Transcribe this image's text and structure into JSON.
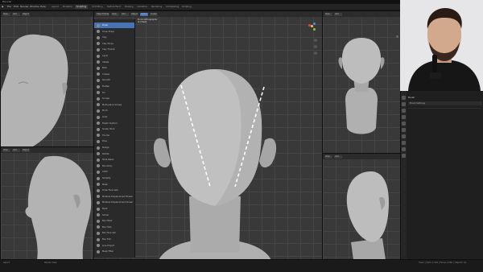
{
  "window": {
    "title": "Blender",
    "controls": [
      "–",
      "□",
      "✕"
    ]
  },
  "menubar": {
    "items": [
      "File",
      "Edit",
      "Render",
      "Window",
      "Help"
    ],
    "workspaces": [
      "Layout",
      "Modeling",
      "Sculpting",
      "UV Editing",
      "Texture Paint",
      "Shading",
      "Animation",
      "Rendering",
      "Compositing",
      "Scripting"
    ],
    "active_workspace": "Sculpting"
  },
  "viewport_main": {
    "header_buttons": [
      "Object Mode",
      "View",
      "Add",
      "Object",
      "Global",
      "Sculpt"
    ],
    "info_line1": "Front Orthographic",
    "info_line2": "(1) Head"
  },
  "viewport_small": {
    "header_buttons": [
      "View",
      "Add",
      "Object"
    ]
  },
  "brushes": {
    "items": [
      {
        "label": "Draw",
        "active": true
      },
      {
        "label": "Draw Sharp",
        "active": false
      },
      {
        "label": "Clay",
        "active": false
      },
      {
        "label": "Clay Strips",
        "active": false
      },
      {
        "label": "Clay Thumb",
        "active": false
      },
      {
        "label": "Layer",
        "active": false
      },
      {
        "label": "Inflate",
        "active": false
      },
      {
        "label": "Blob",
        "active": false
      },
      {
        "label": "Crease",
        "active": false
      },
      {
        "label": "Smooth",
        "active": false
      },
      {
        "label": "Flatten",
        "active": false
      },
      {
        "label": "Fill",
        "active": false
      },
      {
        "label": "Scrape",
        "active": false
      },
      {
        "label": "Multi-plane Scrape",
        "active": false
      },
      {
        "label": "Pinch",
        "active": false
      },
      {
        "label": "Grab",
        "active": false
      },
      {
        "label": "Elastic Deform",
        "active": false
      },
      {
        "label": "Snake Hook",
        "active": false
      },
      {
        "label": "Thumb",
        "active": false
      },
      {
        "label": "Pose",
        "active": false
      },
      {
        "label": "Nudge",
        "active": false
      },
      {
        "label": "Rotate",
        "active": false
      },
      {
        "label": "Slide Relax",
        "active": false
      },
      {
        "label": "Boundary",
        "active": false
      },
      {
        "label": "Cloth",
        "active": false
      },
      {
        "label": "Simplify",
        "active": false
      },
      {
        "label": "Mask",
        "active": false
      },
      {
        "label": "Draw Face Sets",
        "active": false
      },
      {
        "label": "Multires Displacement Eraser",
        "active": false
      },
      {
        "label": "Multires Displacement Smear",
        "active": false
      },
      {
        "label": "Paint",
        "active": false
      },
      {
        "label": "Smear",
        "active": false
      },
      {
        "label": "Box Mask",
        "active": false
      },
      {
        "label": "Box Hide",
        "active": false
      },
      {
        "label": "Box Face Set",
        "active": false
      },
      {
        "label": "Box Trim",
        "active": false
      },
      {
        "label": "Line Project",
        "active": false
      },
      {
        "label": "Mesh Filter",
        "active": false
      }
    ]
  },
  "properties_panel": {
    "section": "Brush",
    "field": "Brush Settings"
  },
  "statusbar": {
    "left": "Select",
    "mid": "Rotate View",
    "right": "Head | Verts 2,582 | Faces 2,560 | Objects 1/1"
  },
  "colors": {
    "accent": "#4772b3",
    "gizmo_x": "#e2434b",
    "gizmo_y": "#8bc34a",
    "gizmo_z": "#4a90e2",
    "gizmo_w": "#f5c542"
  }
}
